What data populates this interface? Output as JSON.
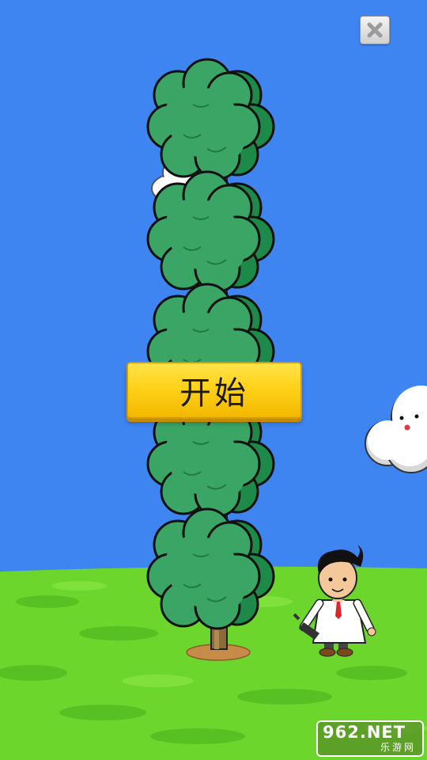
{
  "game": {
    "start_label": "开始",
    "tree_segment_count": 5
  },
  "watermark": {
    "main": "962.NET",
    "sub": "乐游网"
  },
  "icons": {
    "close": "close-x-icon"
  },
  "colors": {
    "sky": "#3f85f2",
    "grass": "#6cd62c",
    "foliage": "#2f9a5a",
    "button_yellow": "#ffd21a",
    "coat": "#ffffff",
    "tie": "#e0242a"
  }
}
